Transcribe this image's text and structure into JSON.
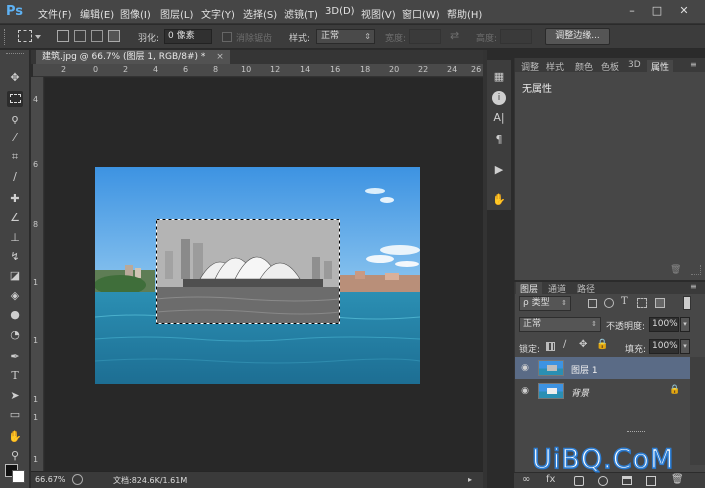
{
  "app": {
    "logo": "Ps",
    "menu": [
      "文件(F)",
      "编辑(E)",
      "图像(I)",
      "图层(L)",
      "文字(Y)",
      "选择(S)",
      "滤镜(T)",
      "3D(D)",
      "视图(V)",
      "窗口(W)",
      "帮助(H)"
    ]
  },
  "options": {
    "feather_label": "羽化:",
    "feather_value": "0 像素",
    "antialias_label": "消除锯齿",
    "style_label": "样式:",
    "style_value": "正常",
    "width_label": "宽度:",
    "height_label": "高度:",
    "refine_edge": "调整边缘..."
  },
  "document": {
    "tab_title": "建筑.jpg @ 66.7% (图层 1, RGB/8#) *",
    "tab_close": "×",
    "ruler_top": [
      "2",
      "0",
      "2",
      "4",
      "6",
      "8",
      "10",
      "12",
      "14",
      "16",
      "18",
      "20",
      "22",
      "24",
      "26"
    ],
    "ruler_left": [
      "4",
      "6",
      "8",
      "1",
      "1",
      "1",
      "1",
      "1"
    ]
  },
  "status": {
    "zoom": "66.67%",
    "doc_info": "文档:824.6K/1.61M"
  },
  "properties_panel": {
    "tabs": [
      "调整",
      "样式",
      "颜色",
      "色板",
      "3D",
      "属性"
    ],
    "active_tab": "属性",
    "content": "无属性"
  },
  "layers_panel": {
    "tabs": [
      "图层",
      "通道",
      "路径"
    ],
    "active_tab": "图层",
    "filter_label": "ρ 类型",
    "blend_mode": "正常",
    "opacity_label": "不透明度:",
    "opacity_value": "100%",
    "lock_label": "锁定:",
    "fill_label": "填充:",
    "fill_value": "100%",
    "layers": [
      {
        "name": "图层 1",
        "selected": true
      },
      {
        "name": "背景",
        "locked": true,
        "italic": true
      }
    ]
  },
  "watermark": "UiBQ.CoM",
  "colors": {
    "menubar": "#464646",
    "panel": "#474747",
    "canvas_bg": "#282828",
    "selected_layer": "#5a6b86",
    "accent_blue": "#5eb2f4"
  }
}
